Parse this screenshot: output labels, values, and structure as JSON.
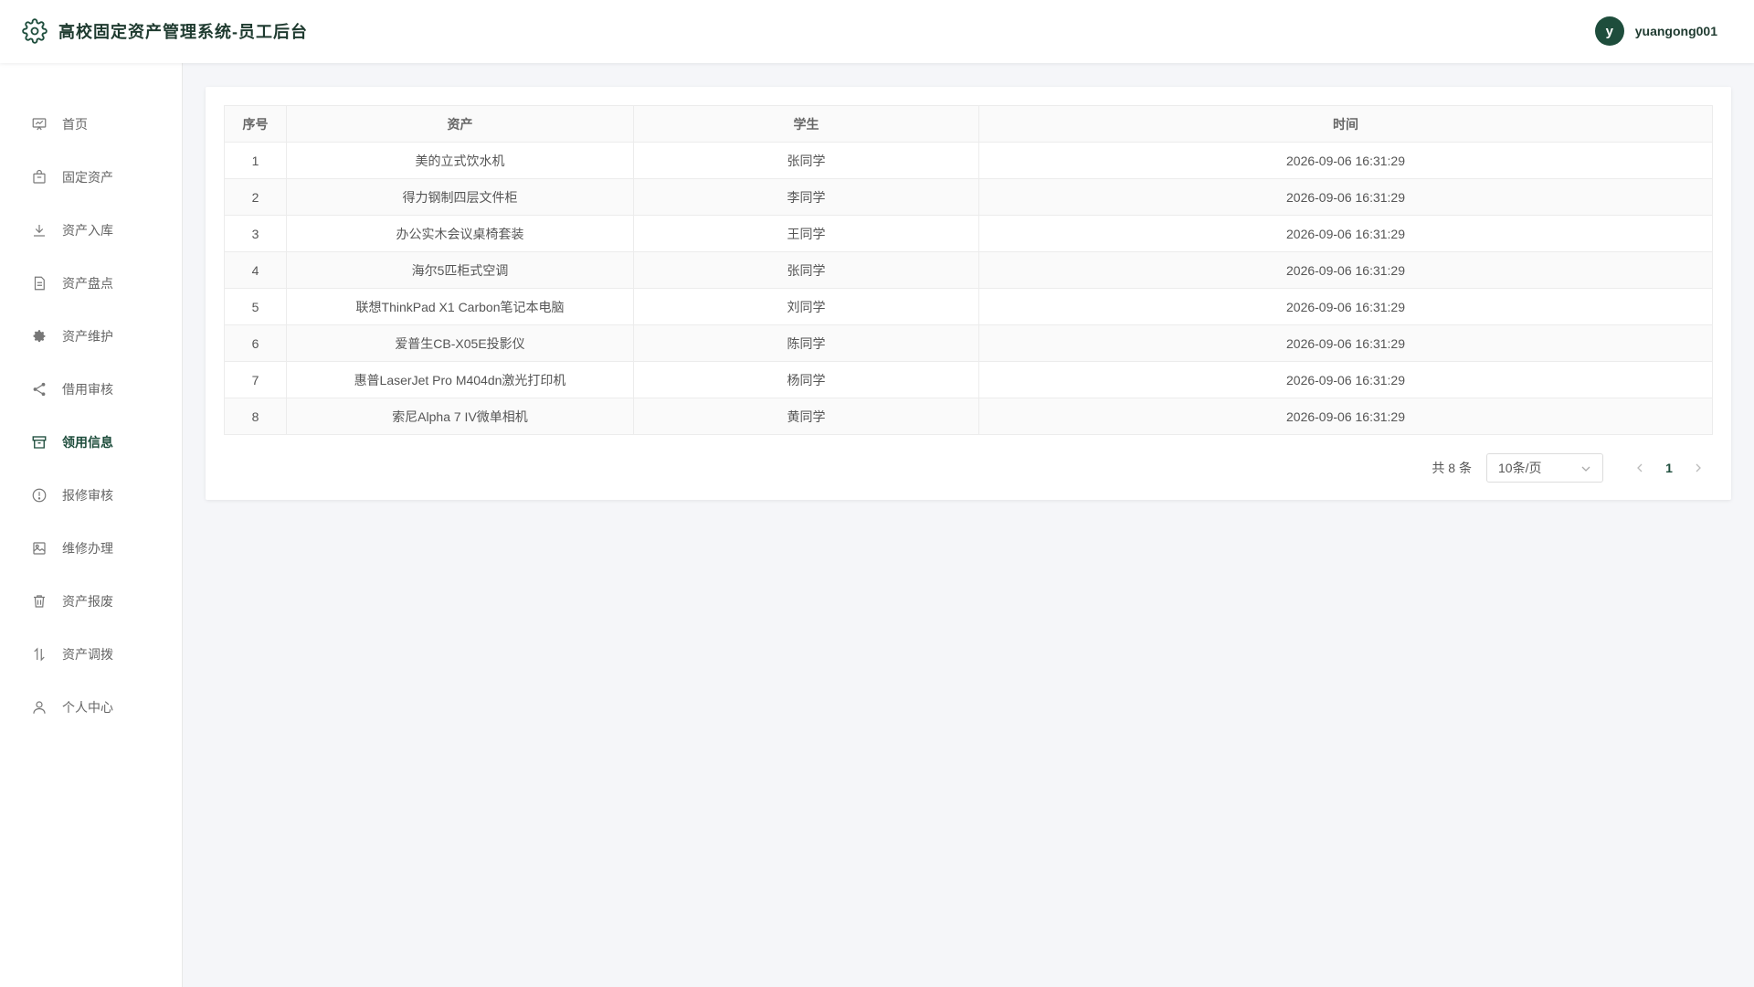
{
  "header": {
    "title": "高校固定资产管理系统-员工后台",
    "avatar_letter": "y",
    "username": "yuangong001"
  },
  "sidebar": {
    "items": [
      {
        "label": "首页",
        "icon": "chart-board-icon"
      },
      {
        "label": "固定资产",
        "icon": "bag-icon"
      },
      {
        "label": "资产入库",
        "icon": "download-icon"
      },
      {
        "label": "资产盘点",
        "icon": "document-icon"
      },
      {
        "label": "资产维护",
        "icon": "gear-icon"
      },
      {
        "label": "借用审核",
        "icon": "share-icon"
      },
      {
        "label": "领用信息",
        "icon": "archive-box-icon",
        "active": true
      },
      {
        "label": "报修审核",
        "icon": "alert-circle-icon"
      },
      {
        "label": "维修办理",
        "icon": "image-icon"
      },
      {
        "label": "资产报废",
        "icon": "trash-icon"
      },
      {
        "label": "资产调拨",
        "icon": "transfer-icon"
      },
      {
        "label": "个人中心",
        "icon": "user-icon"
      }
    ]
  },
  "table": {
    "columns": [
      "序号",
      "资产",
      "学生",
      "时间"
    ],
    "rows": [
      [
        "1",
        "美的立式饮水机",
        "张同学",
        "2026-09-06 16:31:29"
      ],
      [
        "2",
        "得力钢制四层文件柜",
        "李同学",
        "2026-09-06 16:31:29"
      ],
      [
        "3",
        "办公实木会议桌椅套装",
        "王同学",
        "2026-09-06 16:31:29"
      ],
      [
        "4",
        "海尔5匹柜式空调",
        "张同学",
        "2026-09-06 16:31:29"
      ],
      [
        "5",
        "联想ThinkPad X1 Carbon笔记本电脑",
        "刘同学",
        "2026-09-06 16:31:29"
      ],
      [
        "6",
        "爱普生CB-X05E投影仪",
        "陈同学",
        "2026-09-06 16:31:29"
      ],
      [
        "7",
        "惠普LaserJet Pro M404dn激光打印机",
        "杨同学",
        "2026-09-06 16:31:29"
      ],
      [
        "8",
        "索尼Alpha 7 IV微单相机",
        "黄同学",
        "2026-09-06 16:31:29"
      ]
    ]
  },
  "pagination": {
    "total": "共 8 条",
    "page_size": "10条/页",
    "current_page": "1"
  },
  "colors": {
    "accent": "#1e4d3c",
    "background": "#f5f6f9"
  }
}
